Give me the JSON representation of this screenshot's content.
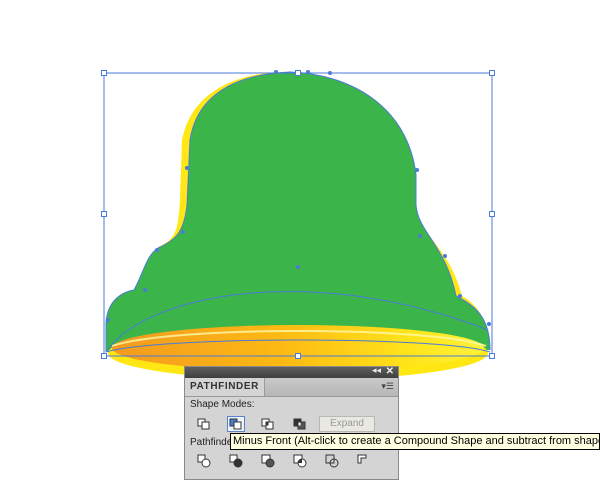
{
  "panel": {
    "title": "PATHFINDER",
    "collapse_icon": "double-chevron-left-icon",
    "close_icon": "close-icon",
    "menu_icon": "panel-menu-icon",
    "shape_modes_label": "Shape Modes:",
    "pathfinders_label": "Pathfinde",
    "shape_mode_buttons": [
      "unite",
      "minus-front",
      "intersect",
      "exclude"
    ],
    "active_shape_mode": "minus-front",
    "expand_label": "Expand",
    "pathfinder_buttons": [
      "divide",
      "trim",
      "merge",
      "crop",
      "outline",
      "minus-back"
    ]
  },
  "tooltip": {
    "text": "Minus Front (Alt-click to create a Compound Shape and subtract from shape"
  },
  "colors": {
    "bell_green": "#3bb44a",
    "bell_rim_yellow": "#ffe714",
    "bell_rim_orange": "#f7941d",
    "selection_blue": "#4a7bd8"
  }
}
